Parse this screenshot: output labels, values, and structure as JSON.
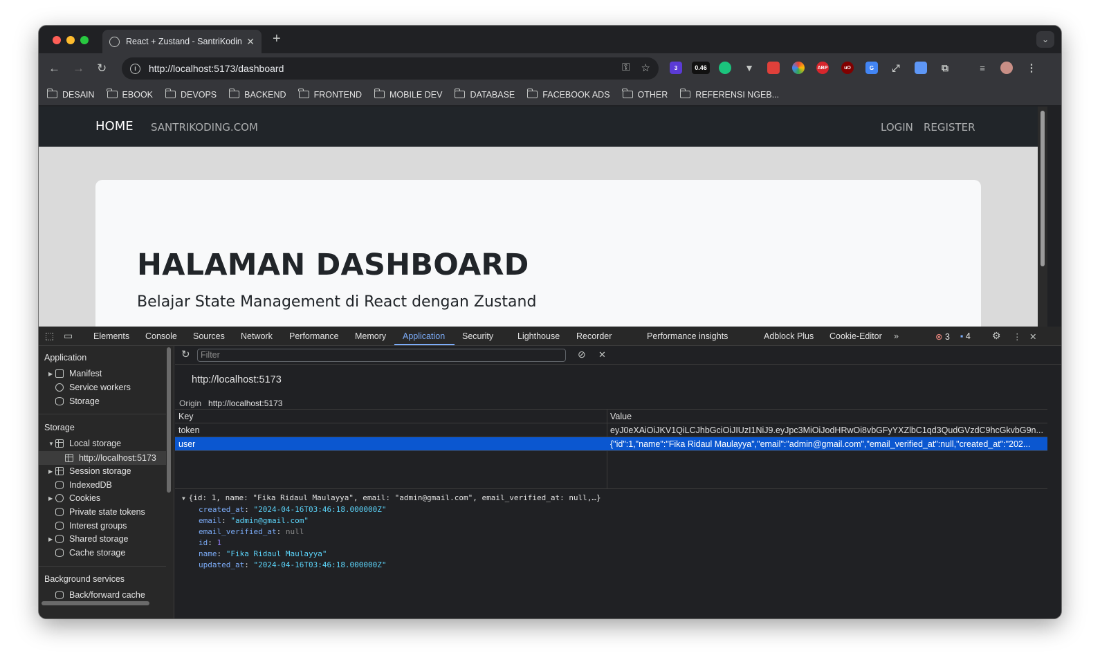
{
  "browser": {
    "tab_title": "React + Zustand - SantriKoding",
    "url": "http://localhost:5173/dashboard",
    "extension_badge": "3",
    "extension_score": "0.46",
    "bookmarks": [
      "DESAIN",
      "EBOOK",
      "DEVOPS",
      "BACKEND",
      "FRONTEND",
      "MOBILE DEV",
      "DATABASE",
      "FACEBOOK ADS",
      "OTHER",
      "REFERENSI NGEB..."
    ]
  },
  "site": {
    "nav_home": "HOME",
    "nav_brand": "SANTRIKODING.COM",
    "nav_login": "LOGIN",
    "nav_register": "REGISTER",
    "heading": "HALAMAN DASHBOARD",
    "lead": "Belajar State Management di React dengan Zustand"
  },
  "devtools": {
    "tabs": [
      "Elements",
      "Console",
      "Sources",
      "Network",
      "Performance",
      "Memory",
      "Application",
      "Security",
      "Lighthouse",
      "Recorder",
      "Performance insights",
      "Adblock Plus",
      "Cookie-Editor"
    ],
    "active_tab": "Application",
    "error_count": "3",
    "message_count": "4",
    "sidebar": {
      "application_title": "Application",
      "application_items": [
        "Manifest",
        "Service workers",
        "Storage"
      ],
      "storage_title": "Storage",
      "storage_items": [
        "Local storage",
        "http://localhost:5173",
        "Session storage",
        "IndexedDB",
        "Cookies",
        "Private state tokens",
        "Interest groups",
        "Shared storage",
        "Cache storage"
      ],
      "background_title": "Background services",
      "background_items": [
        "Back/forward cache"
      ]
    },
    "filter_placeholder": "Filter",
    "origin_heading": "http://localhost:5173",
    "origin_label": "Origin",
    "origin_value": "http://localhost:5173",
    "table": {
      "headers": [
        "Key",
        "Value"
      ],
      "rows": [
        {
          "key": "token",
          "value": "eyJ0eXAiOiJKV1QiLCJhbGciOiJIUzI1NiJ9.eyJpc3MiOiJodHRwOi8vbGFyYXZlbC1qd3QudGVzdC9hcGkvbG9n..."
        },
        {
          "key": "user",
          "value": "{\"id\":1,\"name\":\"Fika Ridaul Maulayya\",\"email\":\"admin@gmail.com\",\"email_verified_at\":null,\"created_at\":\"202..."
        }
      ]
    },
    "preview": {
      "summary": "{id: 1, name: \"Fika Ridaul Maulayya\", email: \"admin@gmail.com\", email_verified_at: null,…}",
      "props": [
        {
          "key": "created_at",
          "value": "\"2024-04-16T03:46:18.000000Z\"",
          "kind": "string"
        },
        {
          "key": "email",
          "value": "\"admin@gmail.com\"",
          "kind": "string"
        },
        {
          "key": "email_verified_at",
          "value": "null",
          "kind": "null"
        },
        {
          "key": "id",
          "value": "1",
          "kind": "number"
        },
        {
          "key": "name",
          "value": "\"Fika Ridaul Maulayya\"",
          "kind": "string"
        },
        {
          "key": "updated_at",
          "value": "\"2024-04-16T03:46:18.000000Z\"",
          "kind": "string"
        }
      ]
    }
  },
  "colors": {
    "accent": "#7cacf8",
    "selection": "#0b57d0",
    "site_nav": "#212529"
  }
}
